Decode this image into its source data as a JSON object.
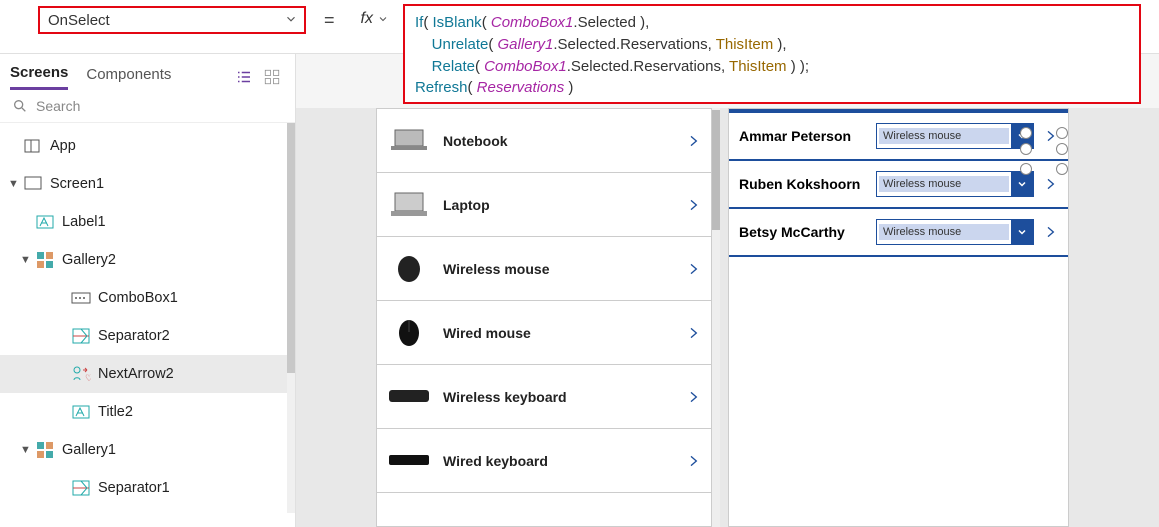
{
  "topbar": {
    "property": "OnSelect",
    "equals": "=",
    "fx_label": "fx",
    "formula_lines": [
      [
        {
          "t": "fn",
          "v": "If"
        },
        {
          "t": "p",
          "v": "( "
        },
        {
          "t": "fn",
          "v": "IsBlank"
        },
        {
          "t": "p",
          "v": "( "
        },
        {
          "t": "obj",
          "v": "ComboBox1"
        },
        {
          "t": "p",
          "v": ".Selected ),"
        }
      ],
      [
        {
          "t": "p",
          "v": "    "
        },
        {
          "t": "fn",
          "v": "Unrelate"
        },
        {
          "t": "p",
          "v": "( "
        },
        {
          "t": "obj",
          "v": "Gallery1"
        },
        {
          "t": "p",
          "v": ".Selected.Reservations, "
        },
        {
          "t": "kw",
          "v": "ThisItem"
        },
        {
          "t": "p",
          "v": " ),"
        }
      ],
      [
        {
          "t": "p",
          "v": "    "
        },
        {
          "t": "fn",
          "v": "Relate"
        },
        {
          "t": "p",
          "v": "( "
        },
        {
          "t": "obj",
          "v": "ComboBox1"
        },
        {
          "t": "p",
          "v": ".Selected.Reservations, "
        },
        {
          "t": "kw",
          "v": "ThisItem"
        },
        {
          "t": "p",
          "v": " ) );"
        }
      ],
      [
        {
          "t": "fn",
          "v": "Refresh"
        },
        {
          "t": "p",
          "v": "( "
        },
        {
          "t": "obj",
          "v": "Reservations"
        },
        {
          "t": "p",
          "v": " )"
        }
      ]
    ]
  },
  "left": {
    "tabs": {
      "screens": "Screens",
      "components": "Components"
    },
    "search_placeholder": "Search",
    "nodes": [
      {
        "label": "App",
        "icon": "app",
        "depth": 0,
        "expand": ""
      },
      {
        "label": "Screen1",
        "icon": "screen",
        "depth": 0,
        "expand": "▼"
      },
      {
        "label": "Label1",
        "icon": "label",
        "depth": 1,
        "expand": ""
      },
      {
        "label": "Gallery2",
        "icon": "gallery",
        "depth": 1,
        "expand": "▼"
      },
      {
        "label": "ComboBox1",
        "icon": "combobox",
        "depth": 2,
        "expand": ""
      },
      {
        "label": "Separator2",
        "icon": "separator",
        "depth": 2,
        "expand": ""
      },
      {
        "label": "NextArrow2",
        "icon": "nextarrow",
        "depth": 2,
        "expand": "",
        "selected": true
      },
      {
        "label": "Title2",
        "icon": "label",
        "depth": 2,
        "expand": ""
      },
      {
        "label": "Gallery1",
        "icon": "gallery",
        "depth": 1,
        "expand": "▼"
      },
      {
        "label": "Separator1",
        "icon": "separator",
        "depth": 2,
        "expand": ""
      }
    ]
  },
  "canvas": {
    "products": [
      {
        "name": "Notebook",
        "img": "laptop-slim"
      },
      {
        "name": "Laptop",
        "img": "laptop"
      },
      {
        "name": "Wireless mouse",
        "img": "mouse"
      },
      {
        "name": "Wired mouse",
        "img": "mouse2"
      },
      {
        "name": "Wireless keyboard",
        "img": "kb"
      },
      {
        "name": "Wired keyboard",
        "img": "kb2"
      }
    ],
    "reservations": [
      {
        "name": "Ammar Peterson",
        "combo": "Wireless mouse",
        "selected": true
      },
      {
        "name": "Ruben Kokshoorn",
        "combo": "Wireless mouse"
      },
      {
        "name": "Betsy McCarthy",
        "combo": "Wireless mouse"
      }
    ]
  }
}
